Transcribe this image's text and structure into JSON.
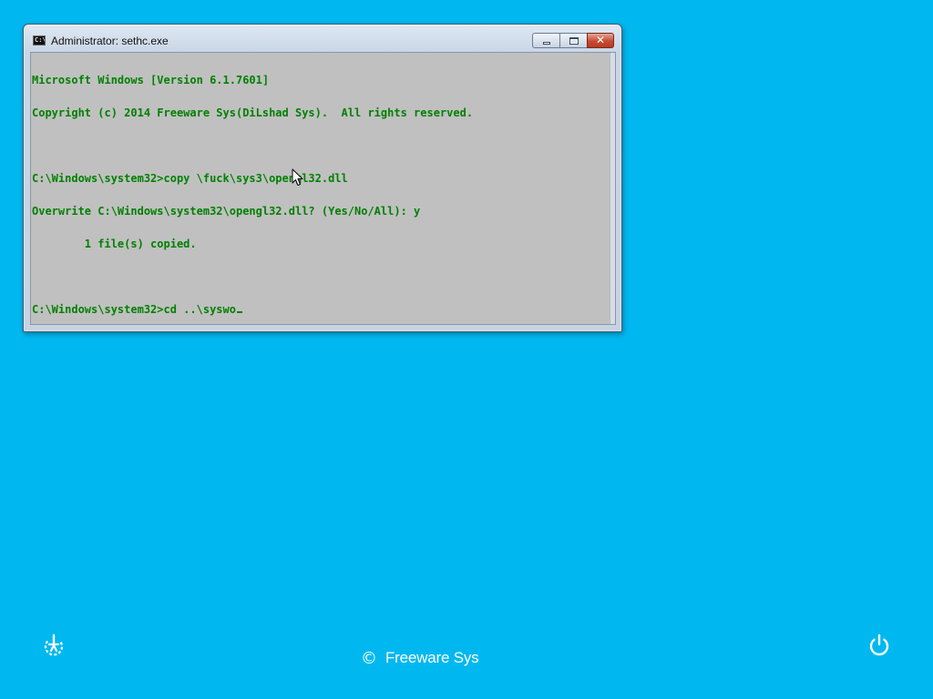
{
  "window": {
    "title": "Administrator: sethc.exe",
    "icon_label": "C:\\",
    "icon": "console-icon",
    "buttons": {
      "minimize": "minimize-icon",
      "maximize": "maximize-icon",
      "close_glyph": "✕"
    }
  },
  "console": {
    "text_color": "#008000",
    "background_color": "#c0c0c0",
    "lines": [
      "Microsoft Windows [Version 6.1.7601]",
      "Copyright (c) 2014 Freeware Sys(DiLshad Sys).  All rights reserved.",
      "",
      "C:\\Windows\\system32>copy \\fuck\\sys3\\opengl32.dll",
      "Overwrite C:\\Windows\\system32\\opengl32.dll? (Yes/No/All): y",
      "        1 file(s) copied.",
      "",
      "C:\\Windows\\system32>cd ..\\syswo"
    ]
  },
  "desktop": {
    "background_color": "#00b8ef"
  },
  "footer": {
    "ease_of_access_icon": "ease-of-access-icon",
    "copyright_symbol": "©",
    "brand": "Freeware Sys",
    "power_icon": "power-icon"
  }
}
